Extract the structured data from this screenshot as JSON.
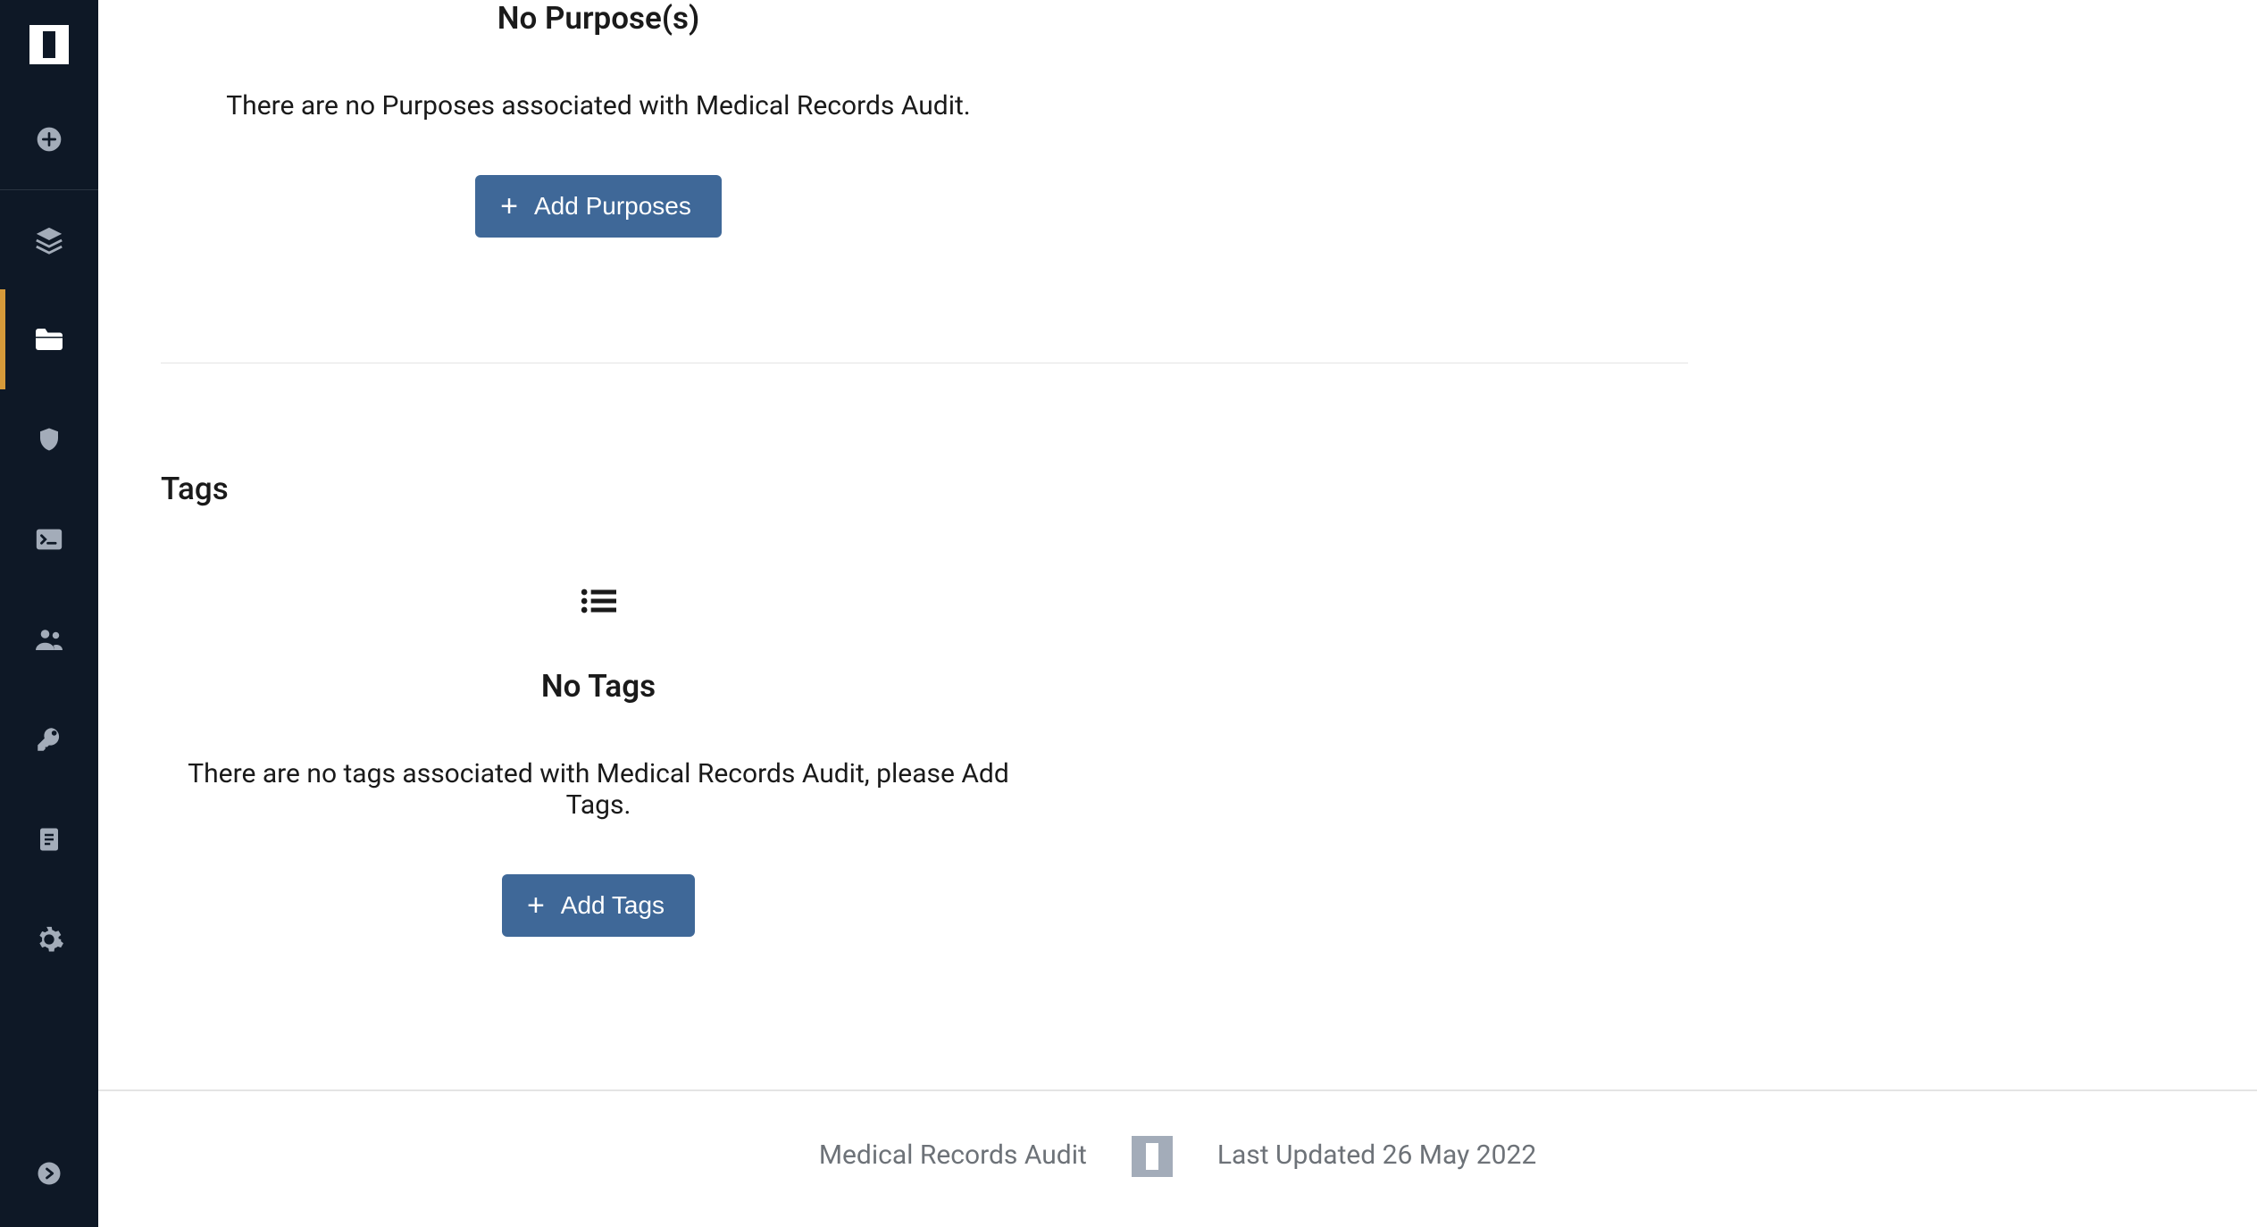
{
  "purposes": {
    "empty_title": "No Purpose(s)",
    "empty_subtitle": "There are no Purposes associated with Medical Records Audit.",
    "add_label": "Add Purposes"
  },
  "tags": {
    "heading": "Tags",
    "empty_title": "No Tags",
    "empty_subtitle": "There are no tags associated with Medical Records Audit, please Add Tags.",
    "add_label": "Add Tags"
  },
  "footer": {
    "project_name": "Medical Records Audit",
    "last_updated": "Last Updated 26 May 2022"
  },
  "sidebar": {
    "items": [
      {
        "name": "add",
        "icon": "plus-circle"
      },
      {
        "name": "layers",
        "icon": "layers"
      },
      {
        "name": "projects",
        "icon": "folder",
        "active": true
      },
      {
        "name": "security",
        "icon": "shield"
      },
      {
        "name": "console",
        "icon": "terminal"
      },
      {
        "name": "users",
        "icon": "people"
      },
      {
        "name": "keys",
        "icon": "key"
      },
      {
        "name": "reports",
        "icon": "document"
      },
      {
        "name": "settings",
        "icon": "gear"
      }
    ],
    "bottom": {
      "name": "next",
      "icon": "arrow-circle"
    }
  }
}
